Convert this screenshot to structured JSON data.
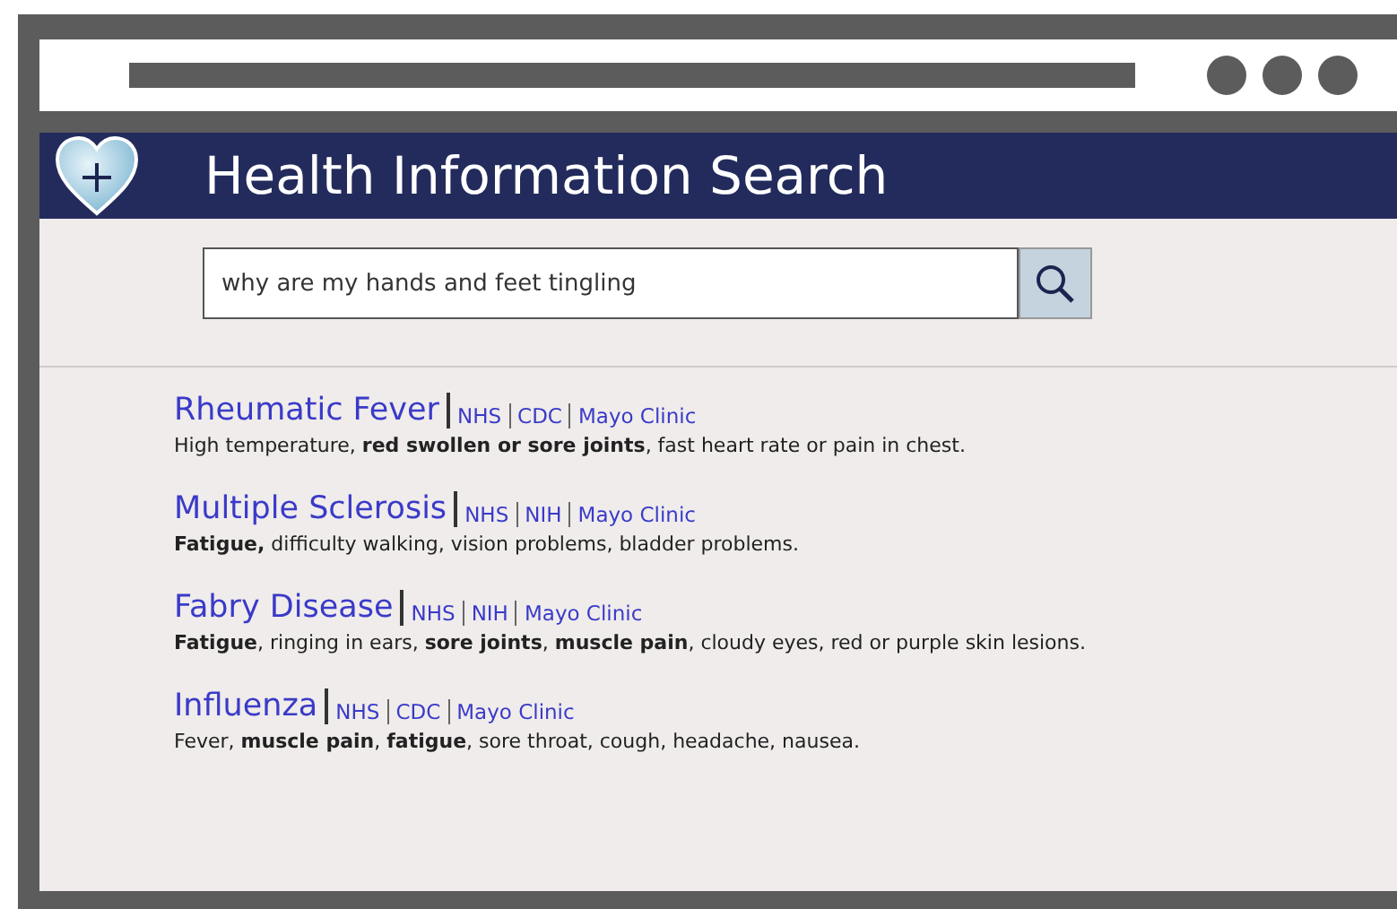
{
  "header": {
    "title": "Health Information Search"
  },
  "search": {
    "value": "why are my hands and feet tingling"
  },
  "results": [
    {
      "title": "Rheumatic Fever",
      "sources": [
        "NHS",
        "CDC",
        "Mayo Clinic"
      ],
      "summary": "High temperature, **red swollen or sore joints**, fast heart rate or pain in chest."
    },
    {
      "title": "Multiple Sclerosis",
      "sources": [
        "NHS",
        "NIH",
        "Mayo Clinic"
      ],
      "summary": "**Fatigue,** difficulty walking, vision problems, bladder problems."
    },
    {
      "title": "Fabry Disease",
      "sources": [
        "NHS",
        "NIH",
        "Mayo Clinic"
      ],
      "summary": "**Fatigue**, ringing in ears, **sore joints**, **muscle pain**, cloudy eyes, red or purple skin lesions."
    },
    {
      "title": "Influenza",
      "sources": [
        "NHS",
        "CDC",
        "Mayo Clinic"
      ],
      "summary": "Fever, **muscle pain**, **fatigue**, sore throat, cough, headache, nausea."
    }
  ]
}
